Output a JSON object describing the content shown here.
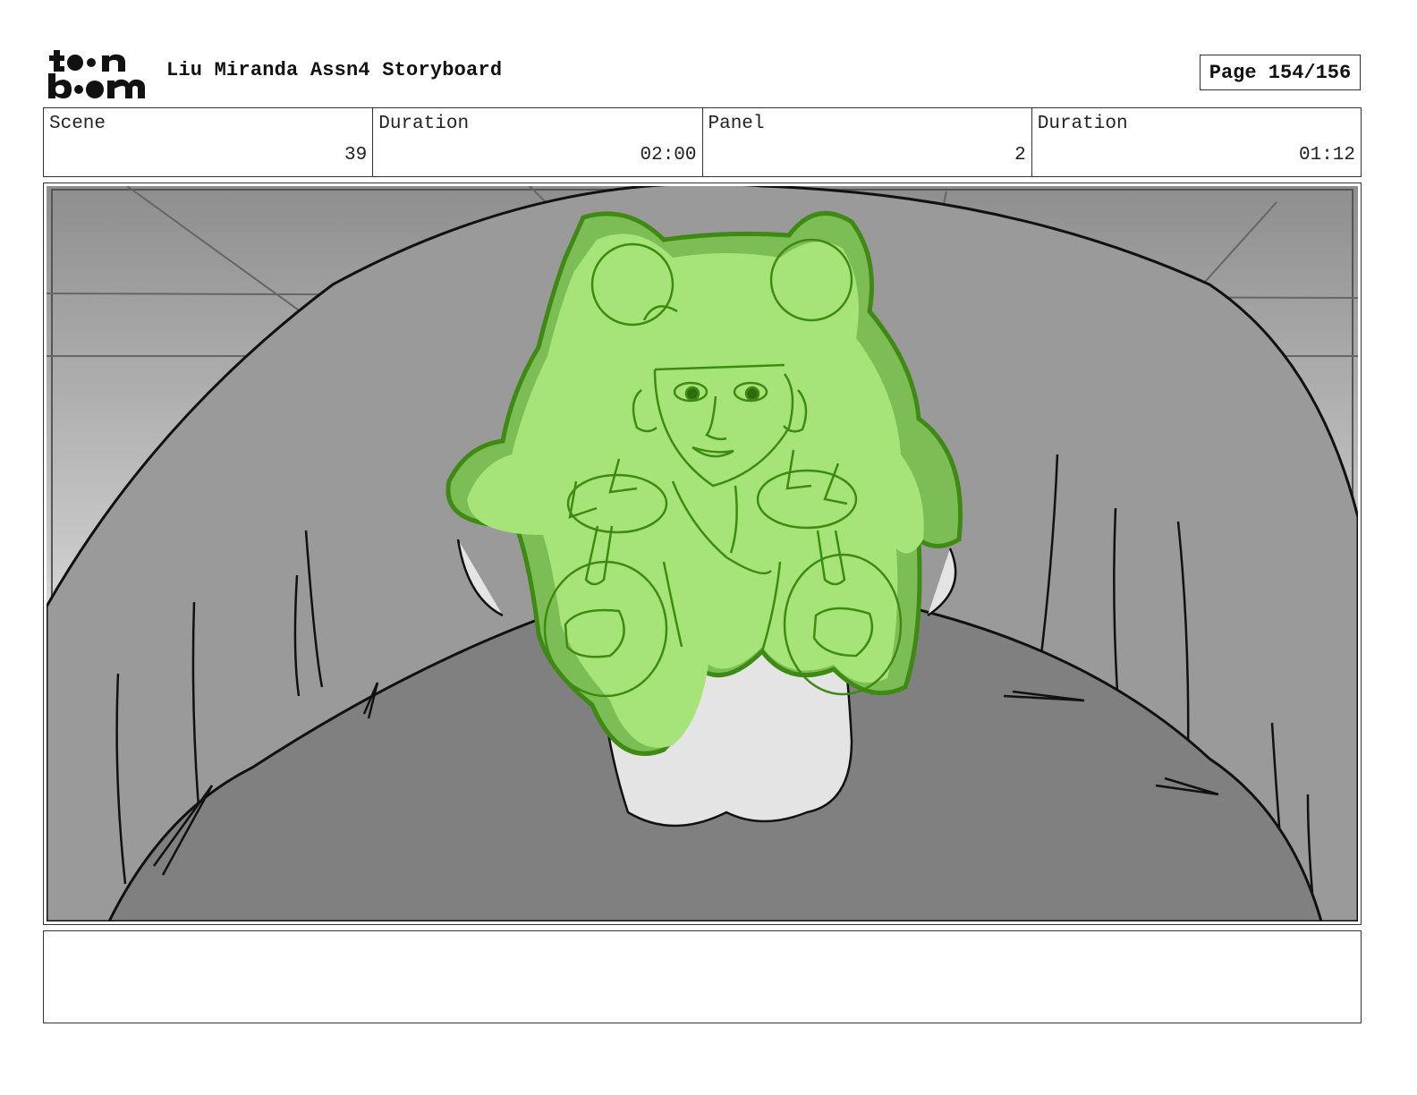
{
  "header": {
    "logo_text": "toon boom",
    "title": "Liu Miranda Assn4 Storyboard",
    "page_label": "Page 154/156"
  },
  "info": {
    "scene_label": "Scene",
    "scene_value": "39",
    "scene_duration_label": "Duration",
    "scene_duration_value": "02:00",
    "panel_label": "Panel",
    "panel_value": "2",
    "panel_duration_label": "Duration",
    "panel_duration_value": "01:12"
  },
  "panel": {
    "description": "",
    "colors": {
      "shield_fill": "#a6e47a",
      "shield_stroke": "#3e8a12",
      "shield_dark": "#7dbd55",
      "background_gray": "#9a9a9a",
      "floor_gray": "#7f7f7f"
    }
  },
  "notes": {
    "text": ""
  }
}
